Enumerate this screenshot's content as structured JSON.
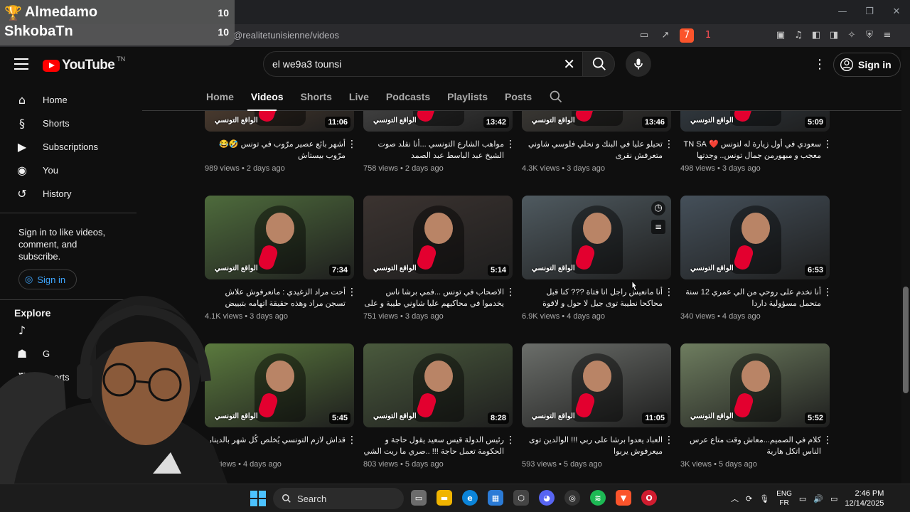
{
  "overlay": {
    "rows": [
      {
        "name": "Almedamo",
        "score": "10"
      },
      {
        "name": "ShkobaTn",
        "score": "10"
      }
    ]
  },
  "browser": {
    "url": "@realitetunisienne/videos",
    "window_controls": [
      "—",
      "❐",
      "✕"
    ],
    "brave_badge": "7",
    "rewards_badge": "1"
  },
  "header": {
    "logo_text": "YouTube",
    "country_code": "TN",
    "search_query": "el we9a3 tounsi",
    "signin_label": "Sign in"
  },
  "tabs": [
    "Home",
    "Videos",
    "Shorts",
    "Live",
    "Podcasts",
    "Playlists",
    "Posts"
  ],
  "active_tab": "Videos",
  "sidebar": {
    "items": [
      {
        "label": "Home",
        "icon": "home-icon"
      },
      {
        "label": "Shorts",
        "icon": "shorts-icon"
      },
      {
        "label": "Subscriptions",
        "icon": "subscriptions-icon"
      },
      {
        "label": "You",
        "icon": "you-icon"
      },
      {
        "label": "History",
        "icon": "history-icon"
      }
    ],
    "signin_prompt": "Sign in to like videos, comment, and subscribe.",
    "signin_button": "Sign in",
    "explore_title": "Explore",
    "explore_items": [
      {
        "label": "",
        "icon": "music-icon"
      },
      {
        "label": "G",
        "icon": "gaming-icon"
      },
      {
        "label": "Sports",
        "icon": "trophy-icon"
      }
    ]
  },
  "videos": [
    {
      "title": "أشهر بائع عصير مرّوب في تونس 🤣😂 مرّوب بيستاش",
      "views": "989 views",
      "age": "2 days ago",
      "duration": "11:06",
      "bg": "#6a4f3a"
    },
    {
      "title": "مواهب الشارع التونسي ...أنا نقلد صوت الشيخ عبد الباسط عبد الصمد",
      "views": "758 views",
      "age": "2 days ago",
      "duration": "13:42",
      "bg": "#5a5a5a"
    },
    {
      "title": "تحيلو عليا في البنك و نحلي فلوسي شاوني متعرفش نقرى",
      "views": "4.3K views",
      "age": "3 days ago",
      "duration": "13:46",
      "bg": "#4e4a43"
    },
    {
      "title": "سعودي في أول زيارة له لتونس ❤️ TN SA معجب و مبهورمن جمال تونس.. وجدتها كما.....",
      "views": "498 views",
      "age": "3 days ago",
      "duration": "5:09",
      "bg": "#3d4a55"
    },
    {
      "title": "أحت مراد الزغيدي : مانعرفوش علاش تسجن مراد وهذه حقيقة اتهامه بتبييض الأموال",
      "views": "4.1K views",
      "age": "3 days ago",
      "duration": "7:34",
      "bg": "#4e6b3c"
    },
    {
      "title": "الاصحاب في تونس ...فمي برشا ناس يخدموا في محاكيهم عليا شاوني طيبة و على نيتي",
      "views": "751 views",
      "age": "3 days ago",
      "duration": "5:14",
      "bg": "#3b3330"
    },
    {
      "title": "أنا مانعيش راجل انا فتاة ??? كنا قبل محاكحا نطيبة توى جيل لا حول و لاقوة",
      "views": "6.9K views",
      "age": "4 days ago",
      "duration": "",
      "bg": "#4f5a60"
    },
    {
      "title": "أنا نخدم على روحي من الي عمري 12 سنة متحمل مسؤولية داردا",
      "views": "340 views",
      "age": "4 days ago",
      "duration": "6:53",
      "bg": "#45505a"
    },
    {
      "title": "قداش لازم التونسي يُخلص كُل شهر بالدينار",
      "views": "1K views",
      "age": "4 days ago",
      "duration": "5:45",
      "bg": "#5b7a3e"
    },
    {
      "title": "رئيس الدولة قيس سعيد يقول حاجة و الحكومة تعمل حاجة !!! ..صري ما ريت الشي هذا",
      "views": "803 views",
      "age": "5 days ago",
      "duration": "8:28",
      "bg": "#4a5a3d"
    },
    {
      "title": "العباد يعدوا برشا على ربي !!! الوالدين توى ميعرفوش يربوا",
      "views": "593 views",
      "age": "5 days ago",
      "duration": "11:05",
      "bg": "#6b6e6a"
    },
    {
      "title": "كلام في الصميم...معاش وقت متاع عرس الناس اتكل هارية",
      "views": "3K views",
      "age": "5 days ago",
      "duration": "5:52",
      "bg": "#6e7d5f"
    }
  ],
  "hover_actions": [
    "clock-icon",
    "add-to-queue-icon"
  ],
  "thumb_brand": "الواقع التونسي",
  "taskbar": {
    "search_label": "Search",
    "apps": [
      "file-explorer-icon",
      "files-folder-icon",
      "edge-icon",
      "store-icon",
      "app-icon",
      "discord-icon",
      "obs-icon",
      "spotify-icon",
      "brave-icon",
      "opera-icon"
    ],
    "lang_top": "ENG",
    "lang_bottom": "FR",
    "time": "2:46 PM",
    "date": "12/14/2025"
  }
}
